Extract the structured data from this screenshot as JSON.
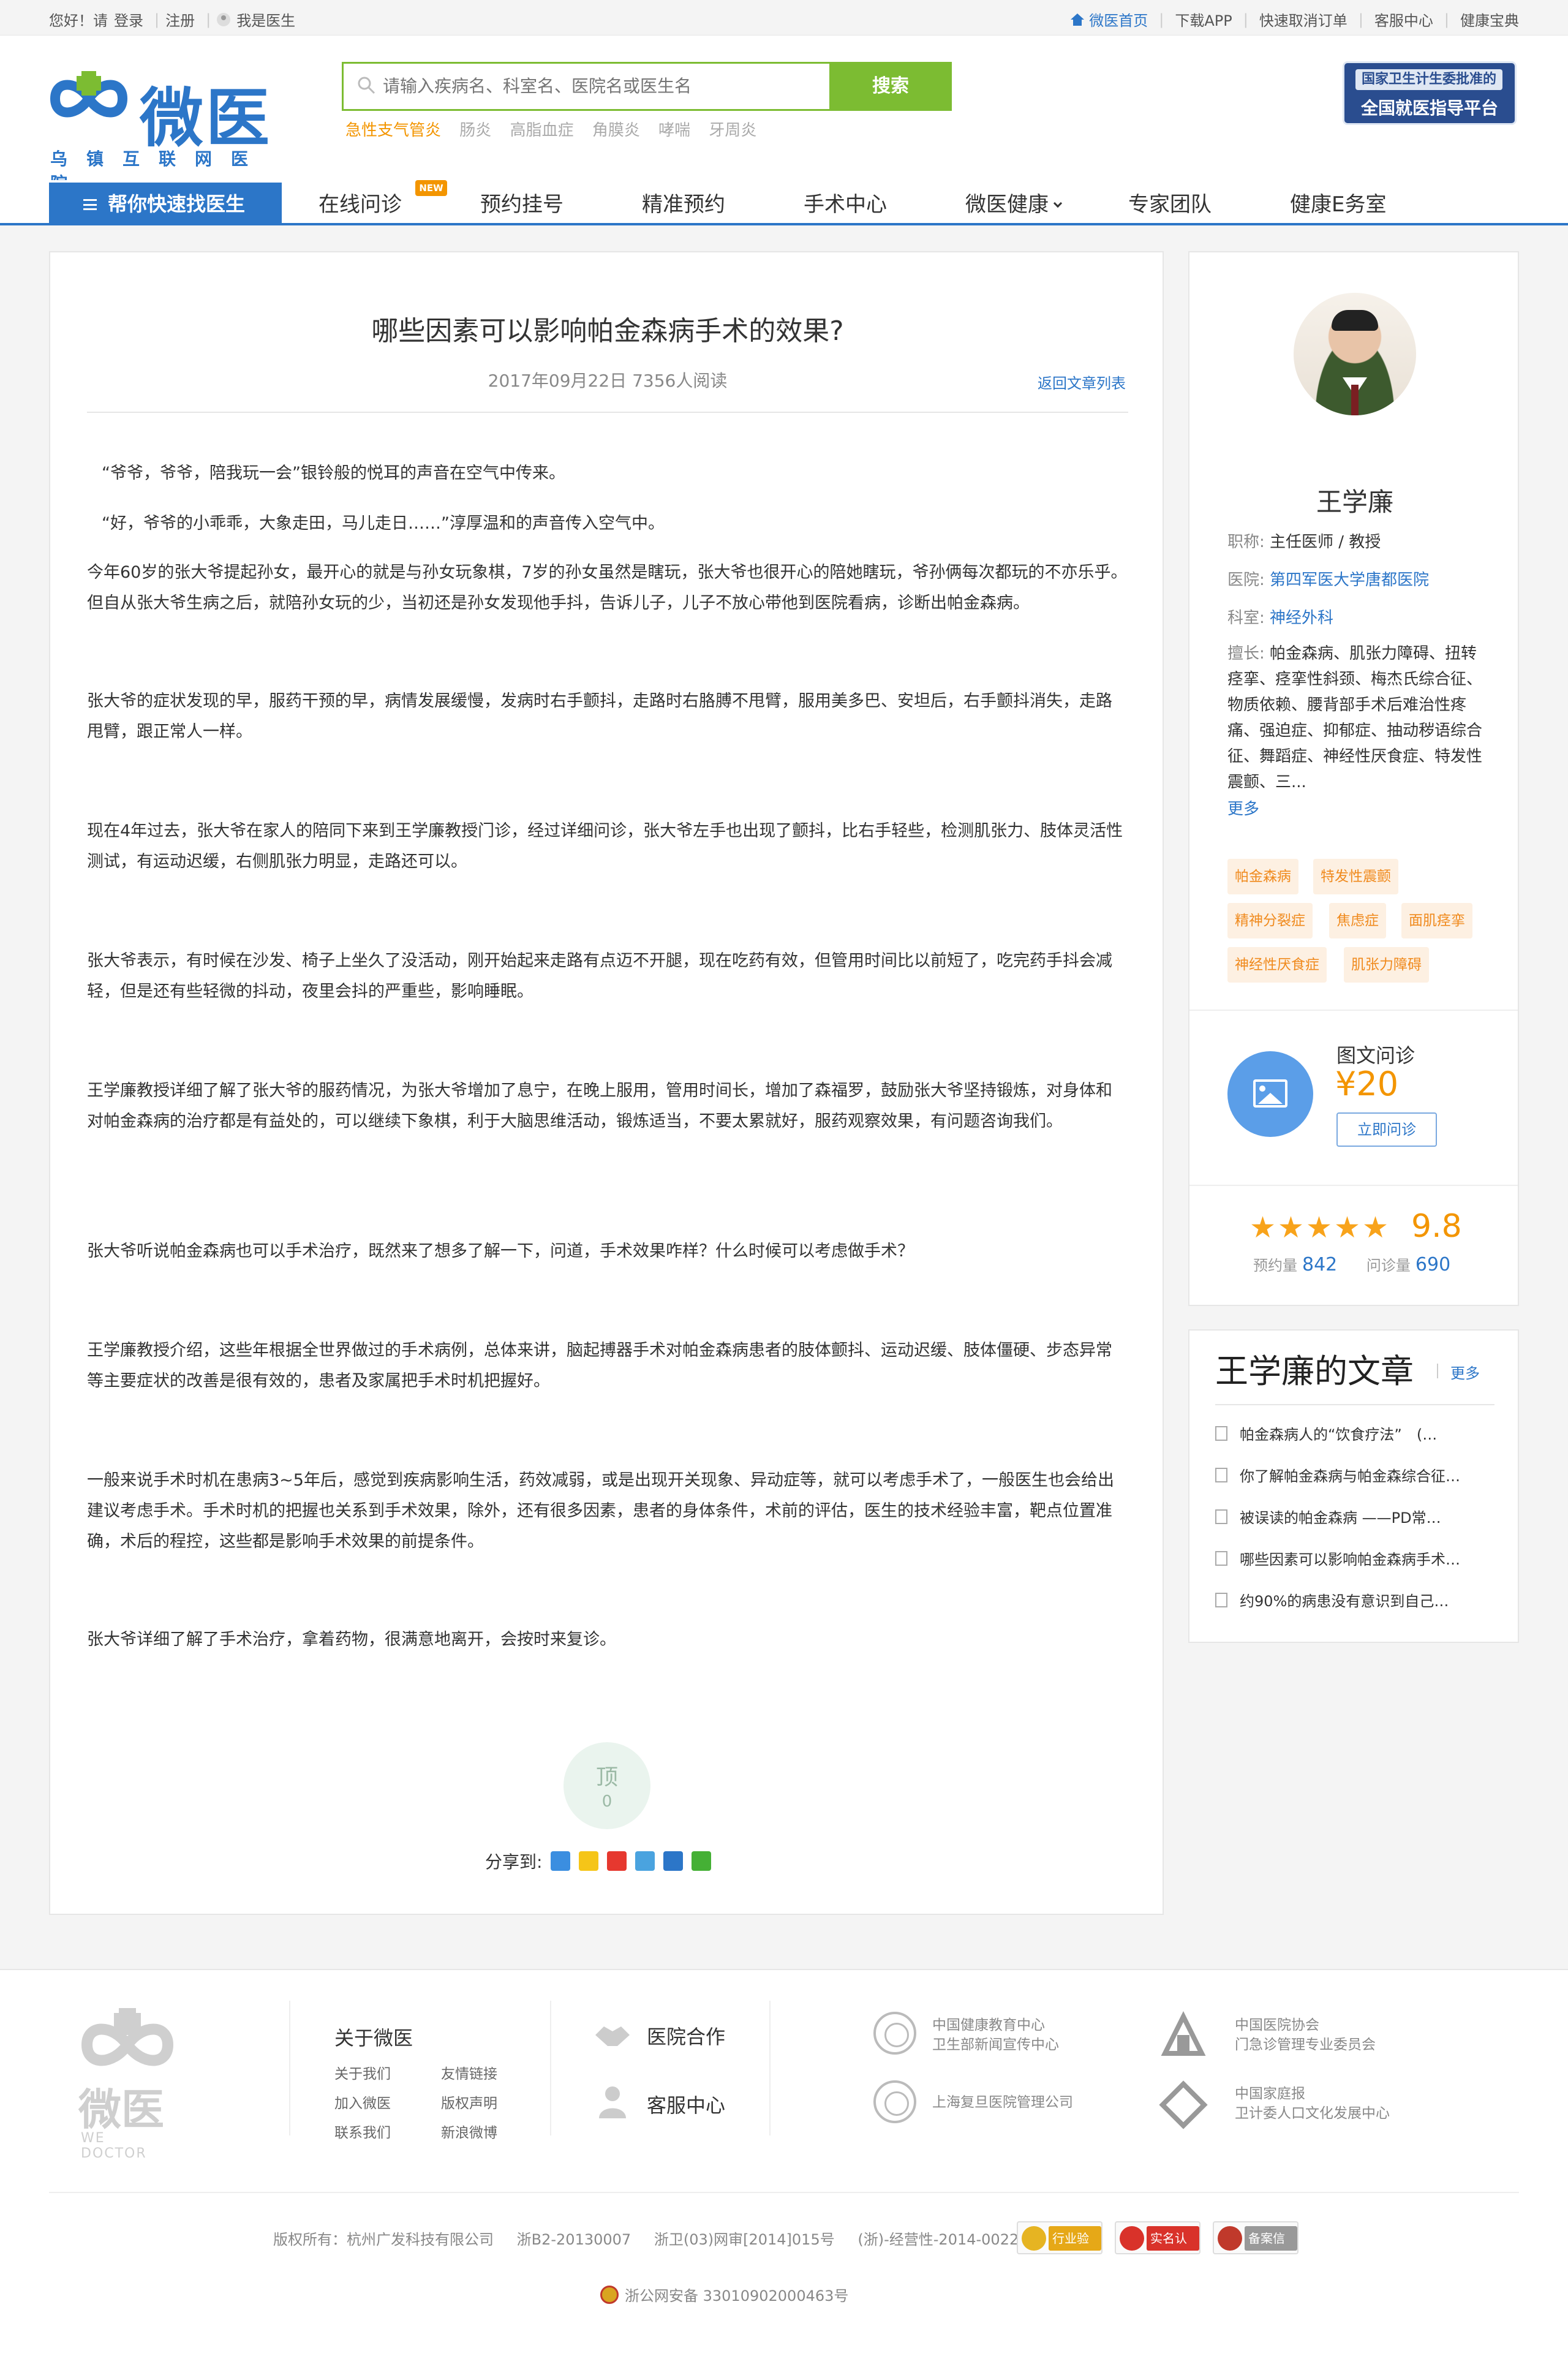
{
  "topbar": {
    "greeting": "您好！请",
    "login": "登录",
    "register": "注册",
    "doctor": "我是医生",
    "links": [
      "微医首页",
      "下载APP",
      "快速取消订单",
      "客服中心",
      "健康宝典"
    ]
  },
  "header": {
    "logo_text": "微医",
    "logo_sub": "乌镇互联网医院",
    "search_placeholder": "请输入疾病名、科室名、医院名或医生名",
    "search_button": "搜索",
    "hotwords": [
      "急性支气管炎",
      "肠炎",
      "高脂血症",
      "角膜炎",
      "哮喘",
      "牙周炎"
    ],
    "badge_line1": "国家卫生计生委批准的",
    "badge_line2": "全国就医指导平台"
  },
  "nav": {
    "find_doctor": "帮你快速找医生",
    "new_tag": "NEW",
    "items": [
      "在线问诊",
      "预约挂号",
      "精准预约",
      "手术中心",
      "微医健康",
      "专家团队",
      "健康E务室"
    ]
  },
  "article": {
    "title": "哪些因素可以影响帕金森病手术的效果?",
    "meta": "2017年09月22日 7356人阅读",
    "back": "返回文章列表",
    "paragraphs": [
      "“爷爷，爷爷，陪我玩一会”银铃般的悦耳的声音在空气中传来。",
      "“好，爷爷的小乖乖，大象走田，马儿走日……”淳厚温和的声音传入空气中。",
      "今年60岁的张大爷提起孙女，最开心的就是与孙女玩象棋，7岁的孙女虽然是瞎玩，张大爷也很开心的陪她瞎玩，爷孙俩每次都玩的不亦乐乎。但自从张大爷生病之后，就陪孙女玩的少，当初还是孙女发现他手抖，告诉儿子，儿子不放心带他到医院看病，诊断出帕金森病。",
      "张大爷的症状发现的早，服药干预的早，病情发展缓慢，发病时右手颤抖，走路时右胳膊不甩臂，服用美多巴、安坦后，右手颤抖消失，走路甩臂，跟正常人一样。",
      "现在4年过去，张大爷在家人的陪同下来到王学廉教授门诊，经过详细问诊，张大爷左手也出现了颤抖，比右手轻些，检测肌张力、肢体灵活性测试，有运动迟缓，右侧肌张力明显，走路还可以。",
      "张大爷表示，有时候在沙发、椅子上坐久了没活动，刚开始起来走路有点迈不开腿，现在吃药有效，但管用时间比以前短了，吃完药手抖会减轻，但是还有些轻微的抖动，夜里会抖的严重些，影响睡眠。",
      "王学廉教授详细了解了张大爷的服药情况，为张大爷增加了息宁，在晚上服用，管用时间长，增加了森福罗，鼓励张大爷坚持锻炼，对身体和对帕金森病的治疗都是有益处的，可以继续下象棋，利于大脑思维活动，锻炼适当，不要太累就好，服药观察效果，有问题咨询我们。",
      "张大爷听说帕金森病也可以手术治疗，既然来了想多了解一下，问道，手术效果咋样？什么时候可以考虑做手术？",
      "王学廉教授介绍，这些年根据全世界做过的手术病例，总体来讲，脑起搏器手术对帕金森病患者的肢体颤抖、运动迟缓、肢体僵硬、步态异常等主要症状的改善是很有效的，患者及家属把手术时机把握好。",
      "一般来说手术时机在患病3~5年后，感觉到疾病影响生活，药效减弱，或是出现开关现象、异动症等，就可以考虑手术了，一般医生也会给出建议考虑手术。手术时机的把握也关系到手术效果，除外，还有很多因素，患者的身体条件，术前的评估，医生的技术经验丰富，靶点位置准确，术后的程控，这些都是影响手术效果的前提条件。",
      "张大爷详细了解了手术治疗，拿着药物，很满意地离开，会按时来复诊。"
    ],
    "vote_label": "顶",
    "vote_count": "0",
    "share_label": "分享到:"
  },
  "doctor": {
    "name": "王学廉",
    "title_label": "职称:",
    "title_value": "主任医师 / 教授",
    "hospital_label": "医院:",
    "hospital_value": "第四军医大学唐都医院",
    "dept_label": "科室:",
    "dept_value": "神经外科",
    "skills_label": "擅长:",
    "skills_value": "帕金森病、肌张力障碍、扭转痉挛、痉挛性斜颈、梅杰氏综合征、物质依赖、腰背部手术后难治性疼痛、强迫症、抑郁症、抽动秽语综合征、舞蹈症、神经性厌食症、特发性震颤、三...",
    "more": "更多",
    "tags": [
      "帕金森病",
      "特发性震颤",
      "精神分裂症",
      "焦虑症",
      "面肌痉挛",
      "神经性厌食症",
      "肌张力障碍"
    ],
    "consult_title": "图文问诊",
    "consult_price": "¥20",
    "consult_button": "立即问诊",
    "rating_stars": 5,
    "score": "9.8",
    "appointments_label": "预约量",
    "appointments": "842",
    "consults_label": "问诊量",
    "consults": "690"
  },
  "doctor_articles": {
    "title": "王学廉的文章",
    "more": "更多",
    "items": [
      "帕金森病人的“饮食疗法”　(…",
      "你了解帕金森病与帕金森综合征…",
      "被误读的帕金森病 ——PD常…",
      "哪些因素可以影响帕金森病手术…",
      "约90%的病患没有意识到自己…"
    ]
  },
  "footer": {
    "logo_cn": "微医",
    "logo_en": "WE DOCTOR",
    "about_title": "关于微医",
    "about_links": [
      "关于我们",
      "友情链接",
      "加入微医",
      "版权声明",
      "联系我们",
      "新浪微博"
    ],
    "coop": "医院合作",
    "service": "客服中心",
    "orgs": [
      [
        "中国健康教育中心",
        "卫生部新闻宣传中心"
      ],
      [
        "中国医院协会",
        "门急诊管理专业委员会"
      ],
      [
        "上海复旦医院管理公司"
      ],
      [
        "中国家庭报",
        "卫计委人口文化发展中心"
      ]
    ],
    "copyright": [
      "版权所有：杭州广发科技有限公司",
      "浙B2-20130007",
      "浙卫(03)网审[2014]015号",
      "(浙)-经营性-2014-0022"
    ],
    "certs": [
      "行业验证",
      "实名认证",
      "备案信息"
    ],
    "police": "浙公网安备 33010902000463号"
  },
  "colors": {
    "brand_blue": "#2c76c8",
    "search_green": "#7cbc32",
    "accent_orange": "#f39500"
  }
}
